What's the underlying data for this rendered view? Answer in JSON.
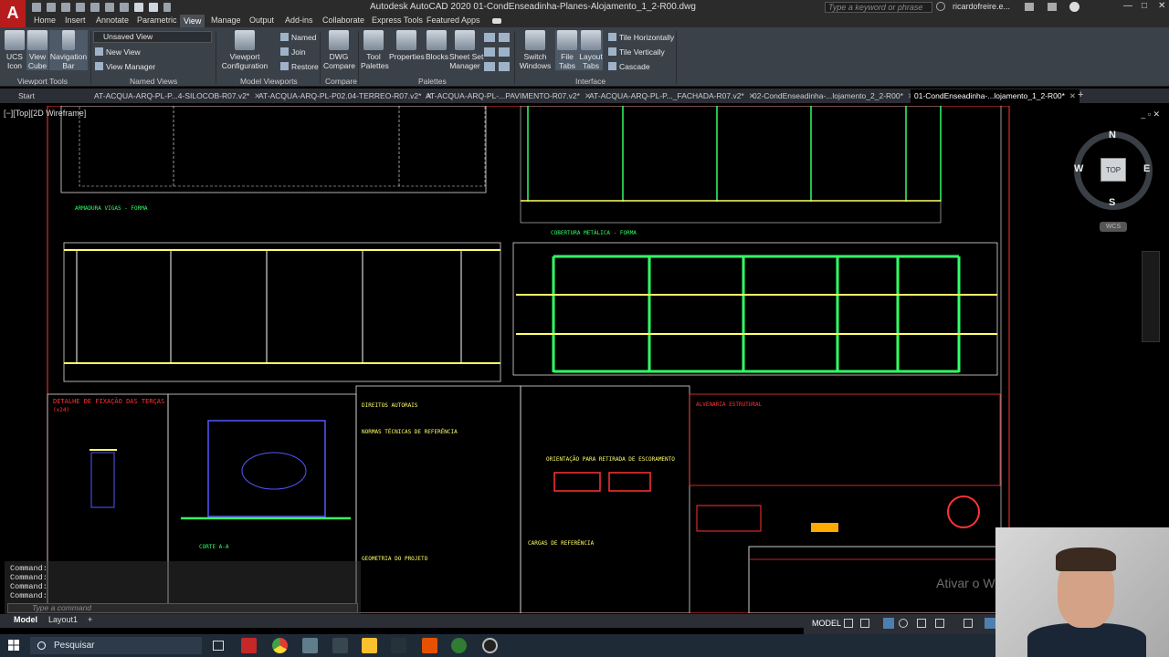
{
  "app": {
    "logo": "A",
    "title": "Autodesk AutoCAD 2020    01-CondEnseadinha-Planes-Alojamento_1_2-R00.dwg",
    "search_placeholder": "Type a keyword or phrase",
    "user": "ricardofreire.e...",
    "minimize": "—",
    "maximize": "□",
    "close": "✕"
  },
  "menu": [
    "Home",
    "Insert",
    "Annotate",
    "Parametric",
    "View",
    "Manage",
    "Output",
    "Add-ins",
    "Collaborate",
    "Express Tools",
    "Featured Apps"
  ],
  "menu_active": "View",
  "ribbon": {
    "ucs_icon": "UCS\nIcon",
    "view_cube": "View\nCube",
    "navigation_bar": "Navigation\nBar",
    "viewport_tools": "Viewport Tools",
    "unsaved_view": "Unsaved View",
    "new_view": "New View",
    "view_manager": "View Manager",
    "named_views": "Named Views",
    "viewport_configuration": "Viewport\nConfiguration",
    "named": "Named",
    "join": "Join",
    "restore": "Restore",
    "model_viewports": "Model Viewports",
    "dwg_compare": "DWG\nCompare",
    "compare": "Compare",
    "tool_palettes": "Tool\nPalettes",
    "properties": "Properties",
    "blocks": "Blocks",
    "sheet_set_manager": "Sheet Set\nManager",
    "palettes": "Palettes",
    "switch_windows": "Switch\nWindows",
    "file_tabs": "File\nTabs",
    "layout_tabs": "Layout\nTabs",
    "tile_horizontally": "Tile Horizontally",
    "tile_vertically": "Tile Vertically",
    "cascade": "Cascade",
    "interface": "Interface"
  },
  "doc_tabs": [
    {
      "label": "Start",
      "active": false
    },
    {
      "label": "AT-ACQUA-ARQ-PL-P...4-SILOCOB-R07.v2*",
      "active": false
    },
    {
      "label": "AT-ACQUA-ARQ-PL-P02.04-TERREO-R07.v2*",
      "active": false
    },
    {
      "label": "AT-ACQUA-ARQ-PL-...PAVIMENTO-R07.v2*",
      "active": false
    },
    {
      "label": "AT-ACQUA-ARQ-PL-P..._FACHADA-R07.v2*",
      "active": false
    },
    {
      "label": "02-CondEnseadinha-...lojamento_2_2-R00*",
      "active": false
    },
    {
      "label": "01-CondEnseadinha-...lojamento_1_2-R00*",
      "active": true
    }
  ],
  "viewport": {
    "label": "[−][Top][2D Wireframe]",
    "controls": "_ ▫ ✕"
  },
  "viewcube": {
    "n": "N",
    "s": "S",
    "e": "E",
    "w": "W",
    "top": "TOP",
    "wcs": "WCS"
  },
  "drawing": {
    "detalhe_fixacao": "DETALHE DE FIXAÇÃO DAS TERÇAS",
    "detalhe_qty": "(x24)",
    "cobertura": "COBERTURA METÁLICA - FORMA",
    "armadura": "ARMADURA VIGAS - FORMA",
    "direitos": "DIREITOS AUTORAIS",
    "normas": "NORMAS TÉCNICAS DE REFERÊNCIA",
    "geometria": "GEOMETRIA DO PROJETO",
    "orientacao": "ORIENTAÇÃO PARA RETIRADA DE ESCORAMENTO",
    "cargas": "CARGAS DE REFERÊNCIA",
    "alvenaria": "ALVENARIA ESTRUTURAL",
    "corte": "CORTE A-A",
    "watermark": "Ativar o W"
  },
  "command": {
    "lines": [
      "Command:",
      "Command:",
      "Command:",
      "Command:"
    ],
    "placeholder": "Type a command"
  },
  "layouts": [
    "Model",
    "Layout1",
    "+"
  ],
  "status": {
    "model": "MODEL"
  },
  "taskbar": {
    "search": "Pesquisar"
  },
  "colors": {
    "cad_green": "#33ff66",
    "cad_yellow": "#ffff66",
    "cad_red": "#ff3333",
    "cad_cyan": "#00ffff",
    "cad_magenta": "#ff33ff",
    "ribbon_bg": "#3b4149",
    "title_bg": "#2b2b2b"
  }
}
